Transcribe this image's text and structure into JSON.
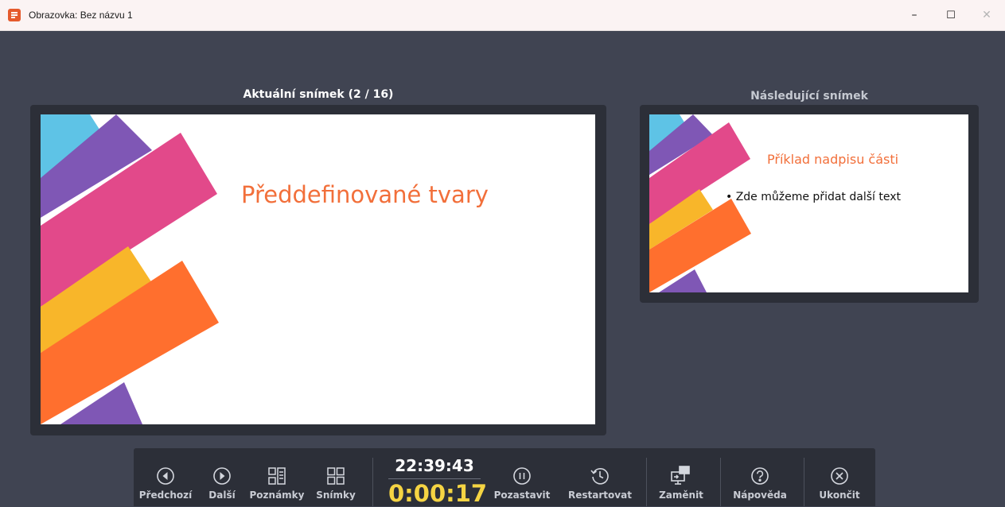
{
  "window": {
    "title": "Obrazovka: Bez názvu 1",
    "controls": {
      "minimize": "–",
      "maximize": "☐",
      "close": "✕"
    }
  },
  "current": {
    "label": "Aktuální snímek (2 / 16)",
    "slide_title": "Předdefinované tvary"
  },
  "next": {
    "label": "Následující snímek",
    "slide_title": "Příklad nadpisu části",
    "bullet": "• Zde můžeme přidat další text"
  },
  "colors": {
    "cyan": "#5ec3e6",
    "purple": "#7f57b5",
    "pink": "#e2498a",
    "yellow": "#f8b62a",
    "orange": "#ff6f2e",
    "title_orange": "#f26f3a",
    "elapsed_yellow": "#f5d443"
  },
  "toolbar": {
    "prev": {
      "label": "Předchozí",
      "icon": "chevron-left-circle-icon"
    },
    "next": {
      "label": "Další",
      "icon": "chevron-right-circle-icon"
    },
    "notes": {
      "label": "Poznámky",
      "icon": "notes-icon"
    },
    "slides": {
      "label": "Snímky",
      "icon": "grid-icon"
    },
    "clock": "22:39:43",
    "elapsed": "0:00:17",
    "pause": {
      "label": "Pozastavit",
      "icon": "pause-circle-icon"
    },
    "restart": {
      "label": "Restartovat",
      "icon": "restart-clock-icon"
    },
    "swap": {
      "label": "Zaměnit",
      "icon": "swap-display-icon"
    },
    "help": {
      "label": "Nápověda",
      "icon": "help-circle-icon"
    },
    "exit": {
      "label": "Ukončit",
      "icon": "close-circle-icon"
    }
  }
}
